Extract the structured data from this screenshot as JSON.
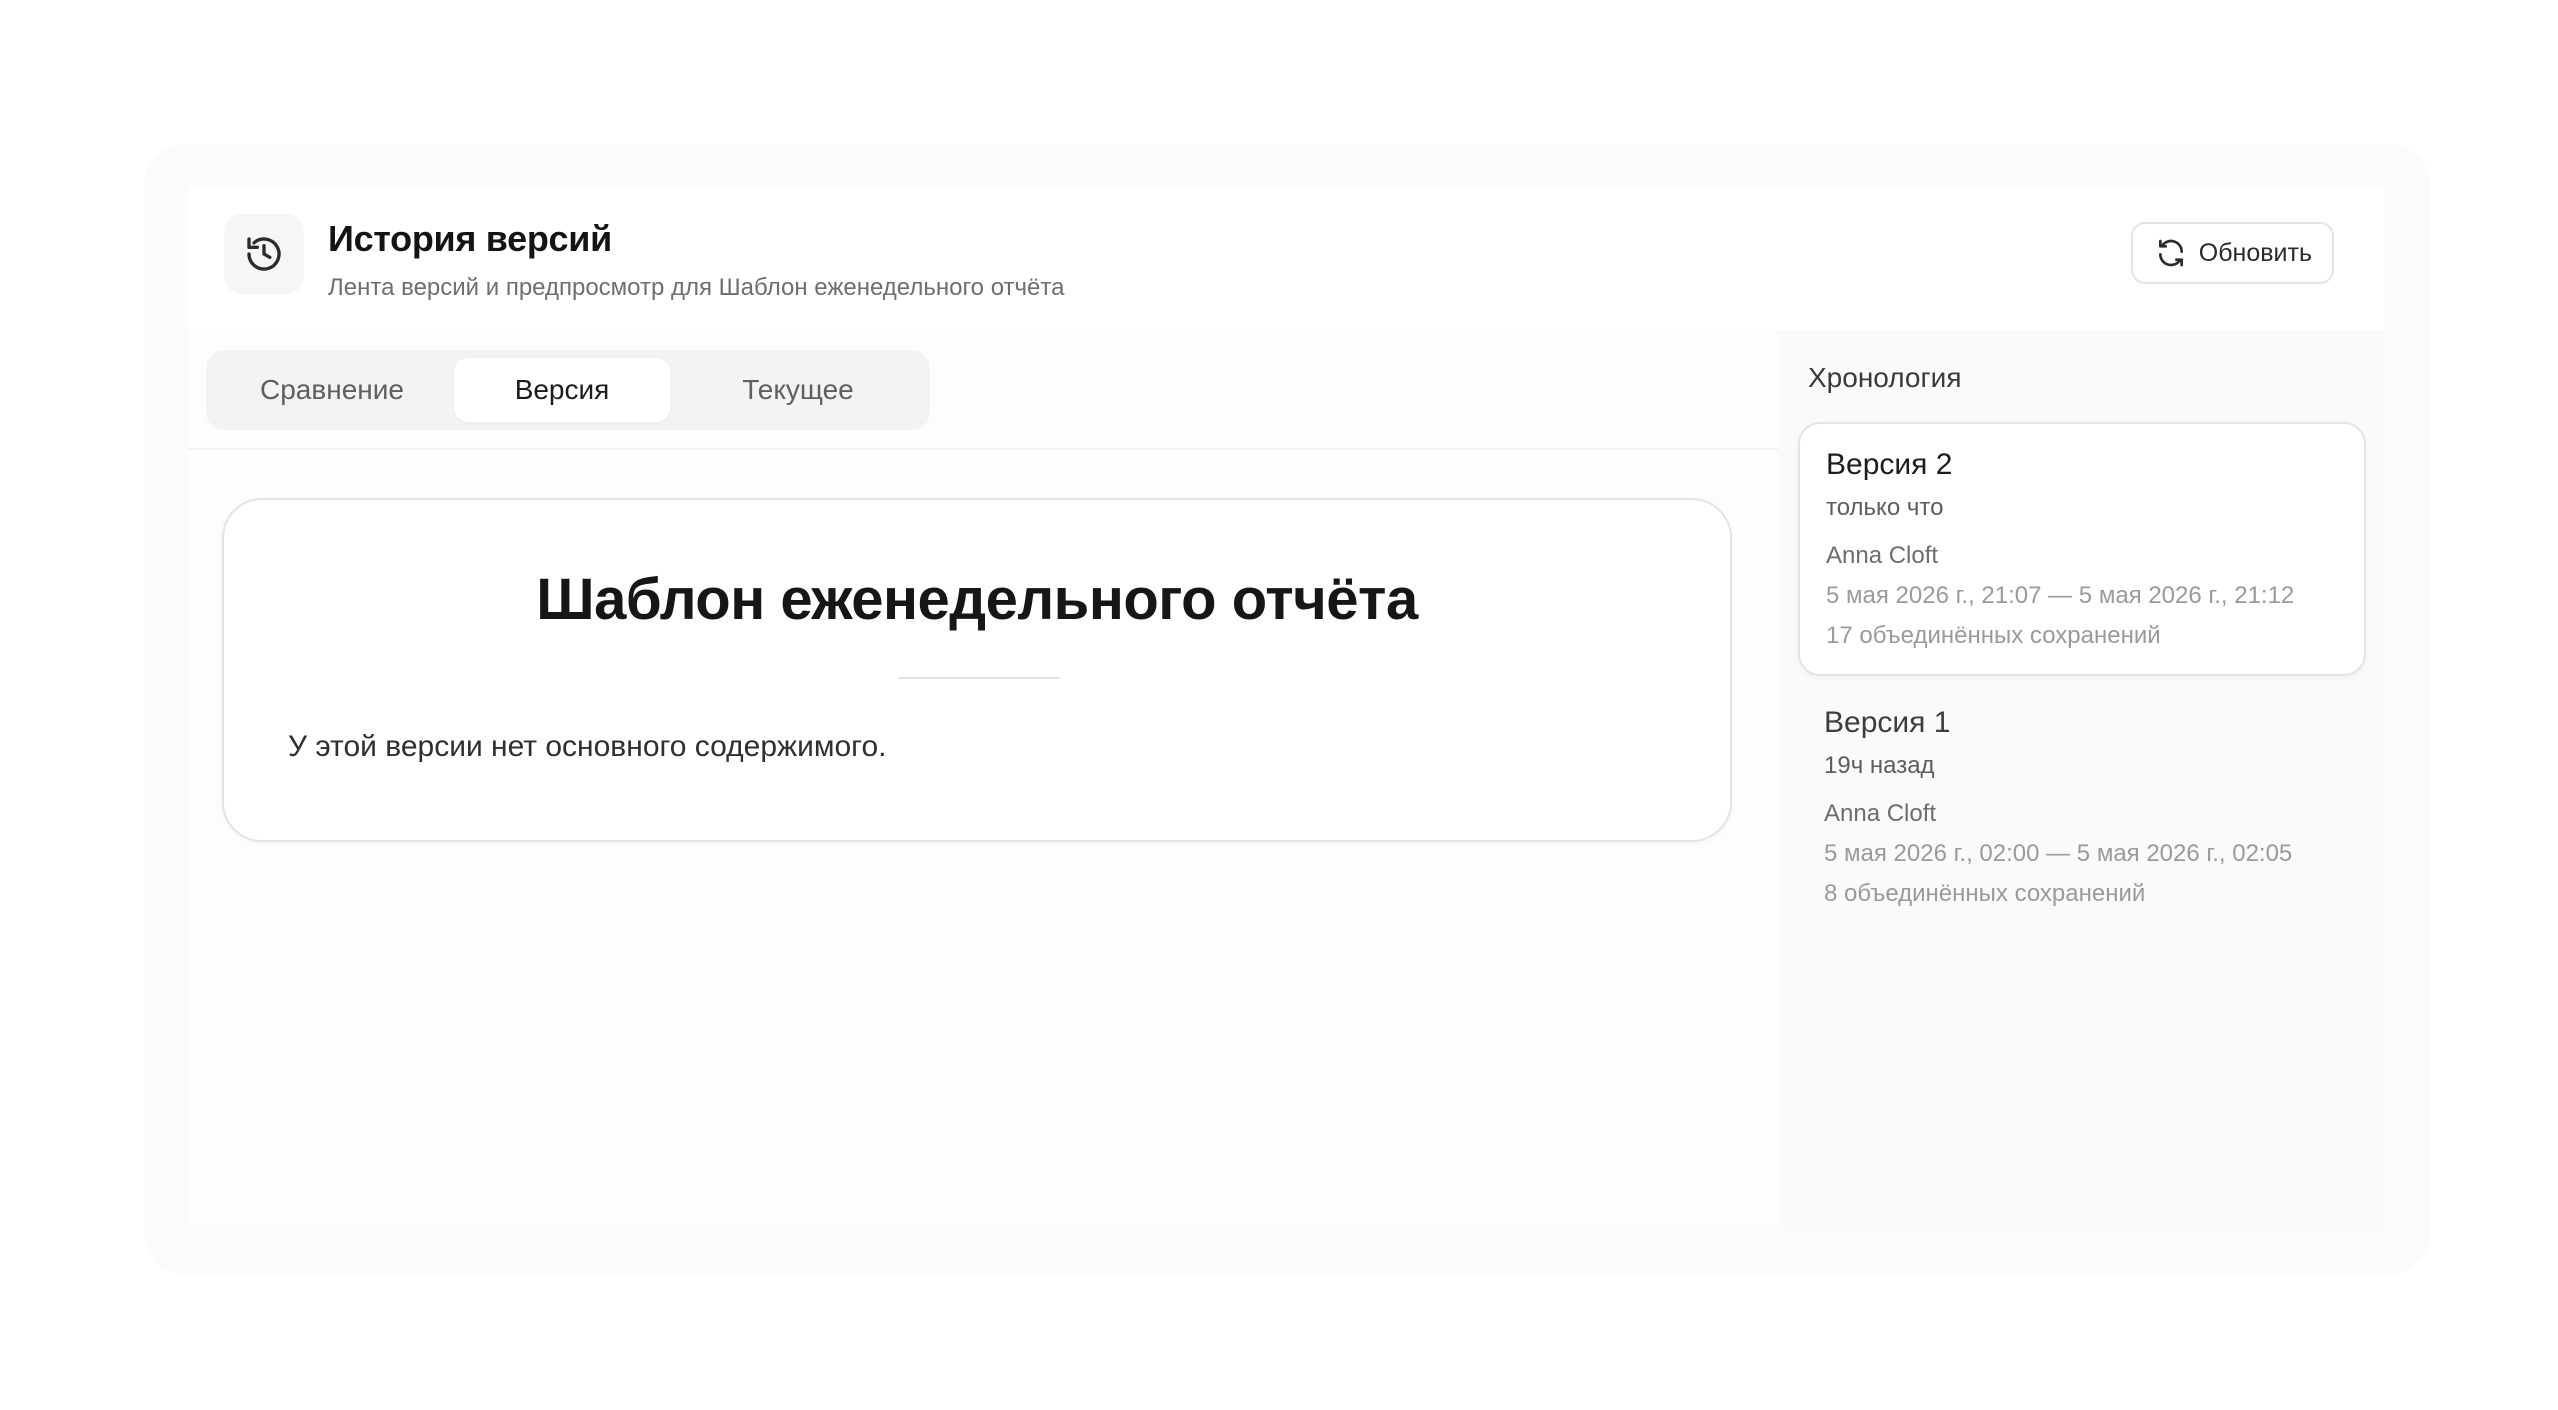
{
  "header": {
    "title": "История версий",
    "subtitle": "Лента версий и предпросмотр для Шаблон еженедельного отчёта",
    "icon": "history-icon",
    "refresh_label": "Обновить",
    "refresh_icon": "refresh-icon"
  },
  "tabs": [
    {
      "label": "Сравнение",
      "active": false
    },
    {
      "label": "Версия",
      "active": true
    },
    {
      "label": "Текущее",
      "active": false
    }
  ],
  "document": {
    "title": "Шаблон еженедельного отчёта",
    "body": "У этой версии нет основного содержимого."
  },
  "timeline": {
    "heading": "Хронология",
    "versions": [
      {
        "name": "Версия 2",
        "relative_time": "только что",
        "author": "Anna Cloft",
        "range": "5 мая 2026 г., 21:07 — 5 мая 2026 г., 21:12",
        "saves": "17 объединённых сохранений",
        "selected": true
      },
      {
        "name": "Версия 1",
        "relative_time": "19ч назад",
        "author": "Anna Cloft",
        "range": "5 мая 2026 г., 02:00 — 5 мая 2026 г., 02:05",
        "saves": "8 объединённых сохранений",
        "selected": false
      }
    ]
  }
}
